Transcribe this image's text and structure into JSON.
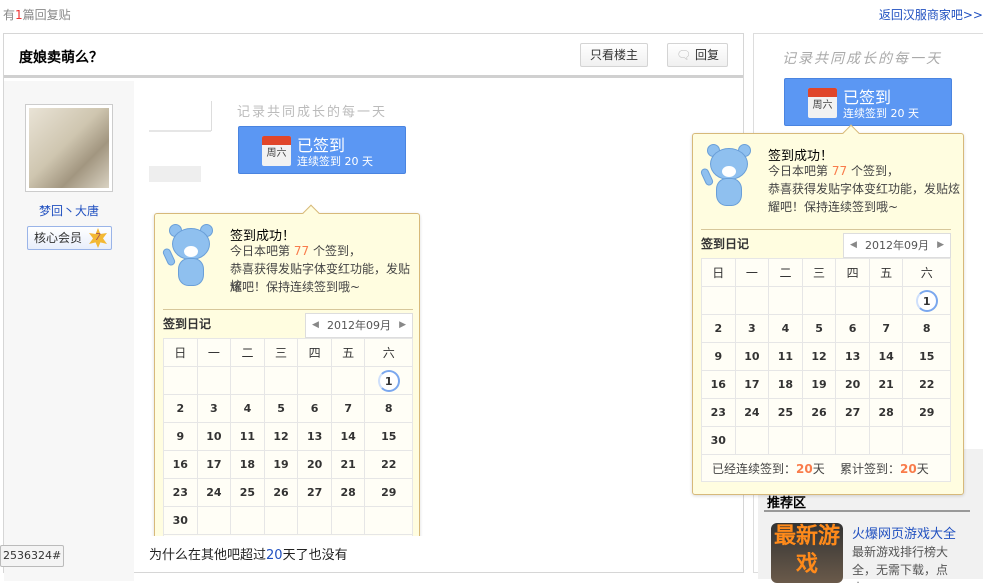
{
  "top": {
    "prefix": "有",
    "count": "1",
    "suffix": "篇回复贴",
    "back_link": "返回汉服商家吧>>"
  },
  "thread": {
    "title": "度娘卖萌么？",
    "only_op_label": "只看楼主",
    "reply_label": "回复"
  },
  "author": {
    "name": "梦回丶大唐",
    "badge": "核心会员",
    "badge_level": "7"
  },
  "post": {
    "text_before": "为什么在其他吧超过",
    "text_num": "20",
    "text_after": "天了也没有",
    "floor": "2536324#"
  },
  "sidebar": {
    "slogan": "记录共同成长的每一天",
    "recommend_title": "推荐区",
    "game_image_text": "最新游戏",
    "game_link": "火爆网页游戏大全",
    "game_desc": "最新游戏排行榜大全，无需下载，点击"
  },
  "signin": {
    "button_status": "已签到",
    "button_streak": "连续签到 20 天",
    "weekday": "周六",
    "popup": {
      "title": "签到成功！",
      "line1_pre": "今日本吧第",
      "rank": "77",
      "line1_post": "个签到，",
      "line2": "恭喜获得发贴字体变红功能，发贴炫",
      "line3": "耀吧！保持连续签到哦~",
      "diary_label": "签到日记",
      "month": "2012年09月",
      "weekdays": [
        "日",
        "一",
        "二",
        "三",
        "四",
        "五",
        "六"
      ],
      "weeks": [
        [
          "",
          "",
          "",
          "",
          "",
          "",
          "1"
        ],
        [
          "2",
          "3",
          "4",
          "5",
          "6",
          "7",
          "8"
        ],
        [
          "9",
          "10",
          "11",
          "12",
          "13",
          "14",
          "15"
        ],
        [
          "16",
          "17",
          "18",
          "19",
          "20",
          "21",
          "22"
        ],
        [
          "23",
          "24",
          "25",
          "26",
          "27",
          "28",
          "29"
        ],
        [
          "30",
          "",
          "",
          "",
          "",
          "",
          ""
        ]
      ],
      "today": "1",
      "streak_label": "已经连续签到：",
      "streak": "20",
      "total_label": "累计签到：",
      "total": "20",
      "day_unit": "天"
    }
  },
  "colors": {
    "accent": "#5b97f3",
    "highlight": "#f97c4b",
    "link": "#2050c0",
    "popup_bg": "#fffde0"
  }
}
